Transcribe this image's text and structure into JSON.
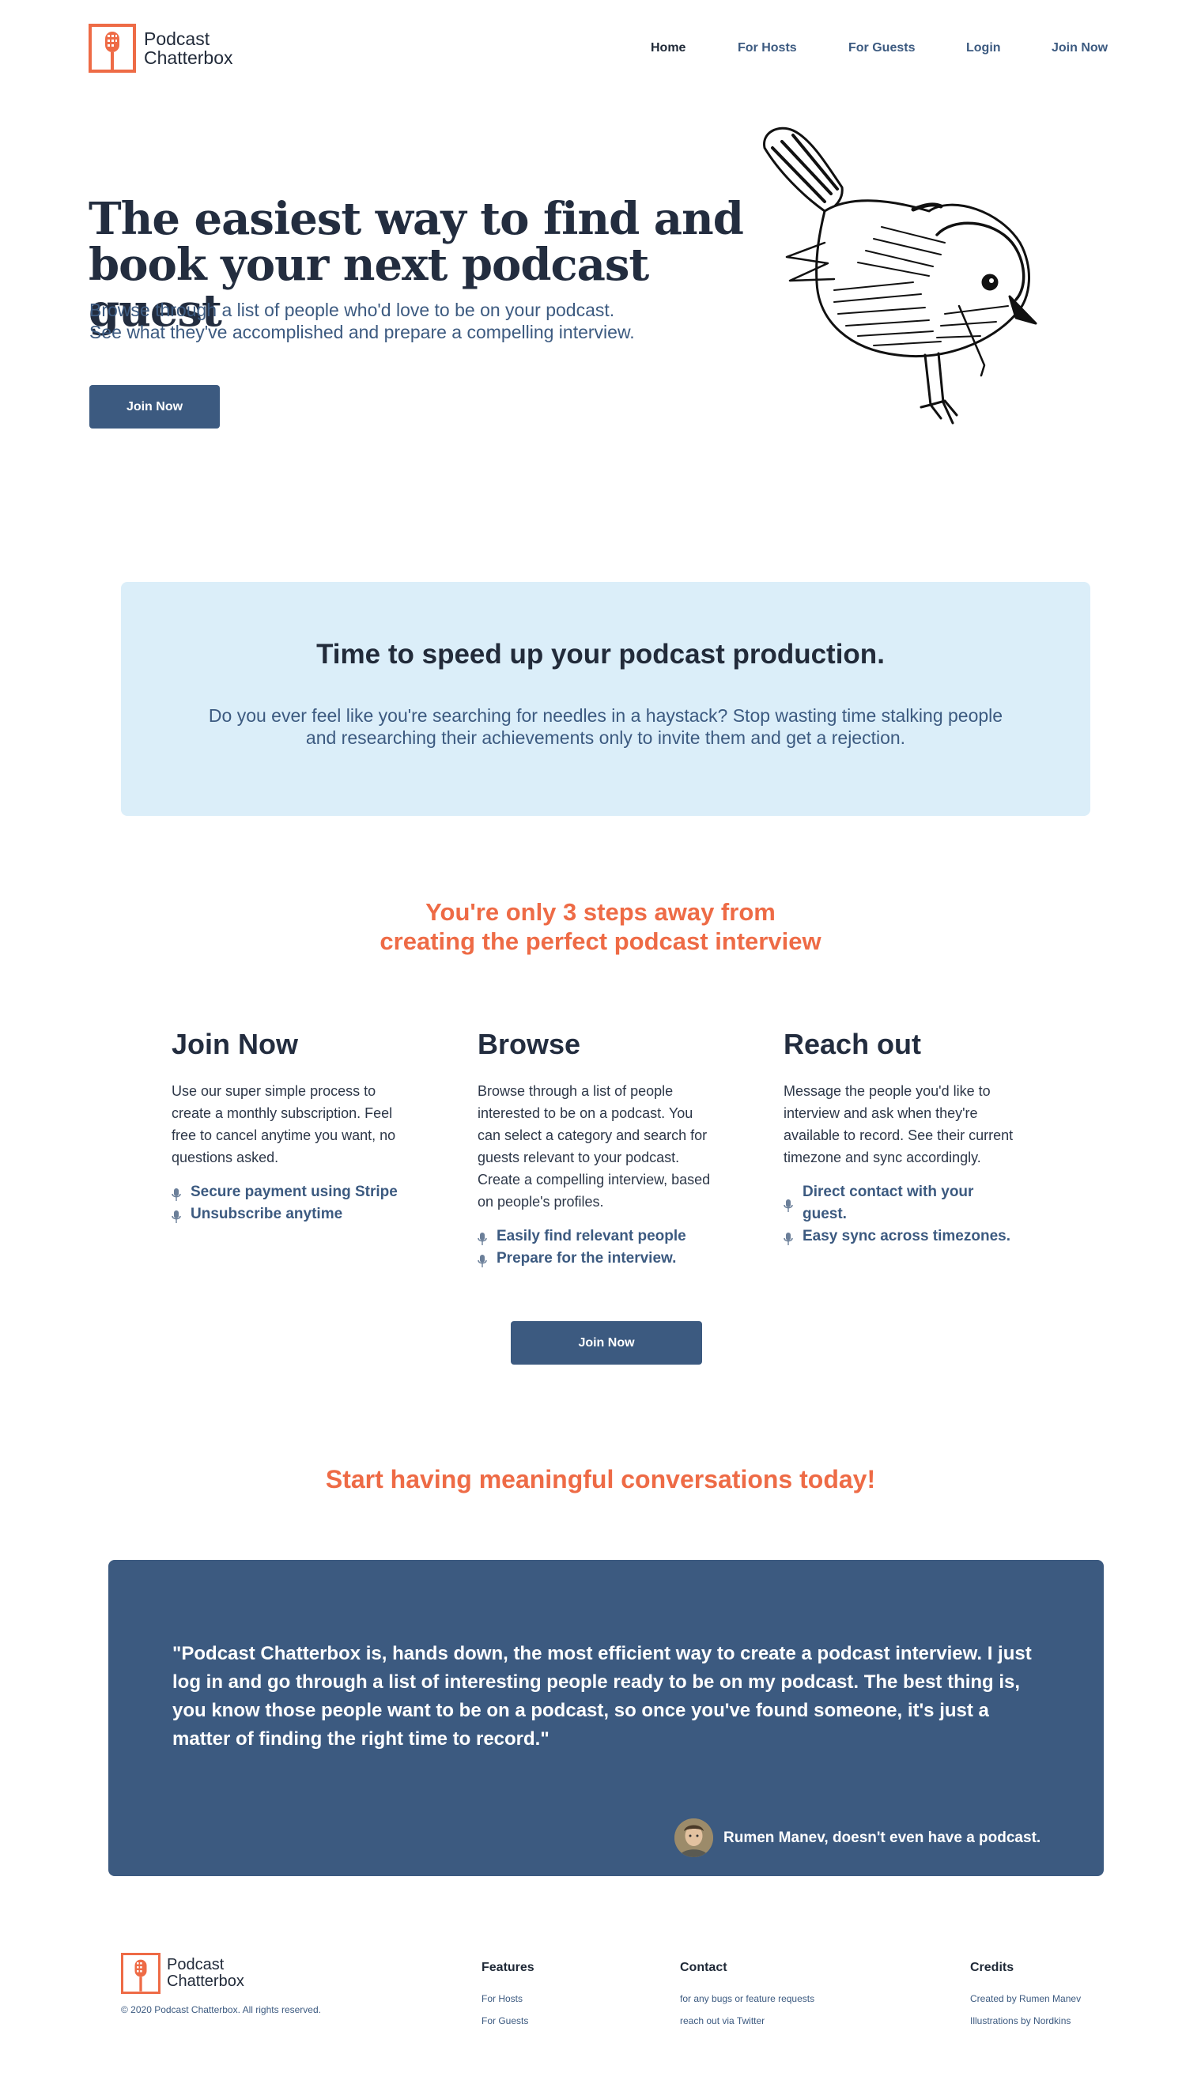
{
  "brand": {
    "name_line1": "Podcast",
    "name_line2": "Chatterbox",
    "accent_color": "#ee6b46",
    "primary_color": "#3c5a80",
    "logo_icon": "microphone-icon"
  },
  "nav": {
    "items": [
      {
        "label": "Home",
        "active": true
      },
      {
        "label": "For Hosts",
        "active": false
      },
      {
        "label": "For Guests",
        "active": false
      },
      {
        "label": "Login",
        "active": false
      },
      {
        "label": "Join Now",
        "active": false
      }
    ]
  },
  "hero": {
    "title_line1": "The easiest way to find and",
    "title_line2": "book your next podcast guest",
    "subtitle_line1": "Browse through a list of people who'd love to be on your podcast.",
    "subtitle_line2": "See what they've accomplished and prepare a compelling interview.",
    "cta_label": "Join Now",
    "illustration": "sparrow-illustration"
  },
  "speed": {
    "title": "Time to speed up your podcast production.",
    "text_line1": "Do you ever feel like you're searching for needles in a haystack? Stop wasting time stalking people",
    "text_line2": "and researching their achievements only to invite them and get a rejection.",
    "background_color": "#dbeef9"
  },
  "steps": {
    "title_line1": "You're only 3 steps away from",
    "title_line2": "creating the perfect podcast interview",
    "items": [
      {
        "heading": "Join Now",
        "text": "Use our super simple process to create a monthly subscription. Feel free to cancel anytime you want, no questions asked.",
        "features": [
          "Secure payment using Stripe",
          "Unsubscribe anytime"
        ]
      },
      {
        "heading": "Browse",
        "text": "Browse through a list of people interested to be on a podcast. You can select a category and search for guests relevant to your podcast. Create a compelling interview, based on people's profiles.",
        "features": [
          "Easily find relevant people",
          "Prepare for the interview."
        ]
      },
      {
        "heading": "Reach out",
        "text": "Message the people you'd like to interview and ask when they're available to record. See their current timezone and sync accordingly.",
        "features": [
          "Direct contact with your guest.",
          "Easy sync across timezones."
        ]
      }
    ],
    "cta_label": "Join Now",
    "bullet_icon": "microphone-icon"
  },
  "testimonial": {
    "heading": "Start having meaningful conversations today!",
    "quote": "\"Podcast Chatterbox is, hands down, the most efficient way to create a podcast interview. I just log in and go through a list of interesting people ready to be on my podcast. The best thing is, you know those people want to be on a podcast, so once you've found someone, it's just a matter of finding the right time to record.\"",
    "author": "Rumen Manev, doesn't even have a podcast."
  },
  "footer": {
    "copyright": "© 2020 Podcast Chatterbox. All rights reserved.",
    "columns": [
      {
        "heading": "Features",
        "links": [
          "For Hosts",
          "For Guests"
        ]
      },
      {
        "heading": "Contact",
        "links": [
          "for any bugs or feature requests",
          "reach out via Twitter"
        ]
      },
      {
        "heading": "Credits",
        "links": [
          "Created by Rumen Manev",
          "Illustrations by Nordkins"
        ]
      }
    ]
  }
}
